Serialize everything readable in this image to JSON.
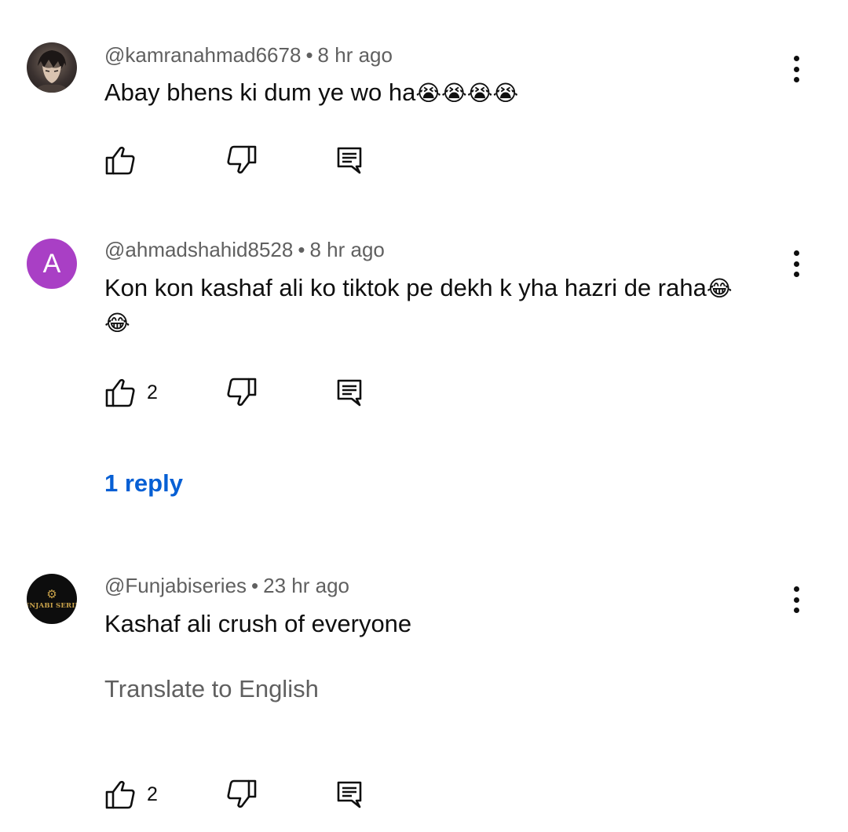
{
  "comments": [
    {
      "handle": "@kamranahmad6678",
      "time": "8 hr ago",
      "separator": "•",
      "text": "Abay bhens ki dum ye wo ha",
      "emoji": "😭😭😭😭",
      "avatar": "anime-portrait-avatar",
      "likes": ""
    },
    {
      "handle": "@ahmadshahid8528",
      "time": "8 hr ago",
      "separator": "•",
      "text": "Kon kon kashaf ali ko tiktok pe dekh k yha hazri de raha",
      "emoji": "😂",
      "emoji2": "😂",
      "avatar_letter": "A",
      "avatar_color": "#a93fc5",
      "likes": "2",
      "replies": "1 reply"
    },
    {
      "handle": "@Funjabiseries",
      "time": "23 hr ago",
      "separator": "•",
      "text": "Kashaf ali crush of everyone",
      "translate": "Translate to English",
      "avatar_logo_text": "FUNJABI SERIES",
      "likes": "2"
    }
  ],
  "colors": {
    "link": "#065fd4",
    "meta": "#606060",
    "text": "#0f0f0f"
  },
  "icons": [
    "like-icon",
    "dislike-icon",
    "reply-icon",
    "more-vert-icon"
  ]
}
